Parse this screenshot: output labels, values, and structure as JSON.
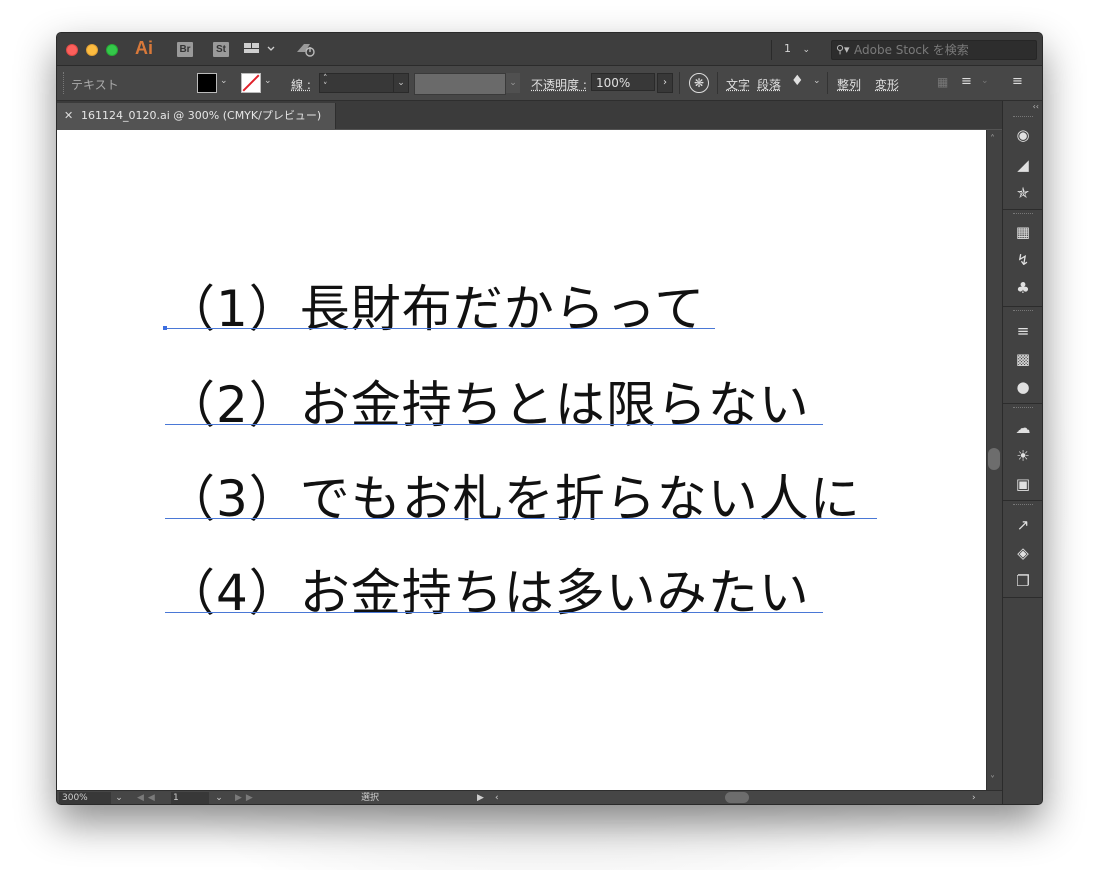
{
  "titlebar": {
    "app_logo": "Ai",
    "bridge_label": "Br",
    "stock_label": "St",
    "workspace_icon": "workspace-grid-icon",
    "sync_icon": "gpu-sync-icon",
    "page_number": "1",
    "search_placeholder": "Adobe Stock を検索"
  },
  "controlbar": {
    "selection_label": "テキスト",
    "fill_color": "#000000",
    "stroke_color": "none",
    "stroke_label": "線",
    "opacity_label": "不透明度",
    "opacity_value": "100%",
    "character_label": "文字",
    "paragraph_label": "段落",
    "align_label": "整列",
    "transform_label": "変形"
  },
  "document_tab": {
    "title": "161124_0120.ai @ 300% (CMYK/プレビュー)"
  },
  "canvas": {
    "lines": [
      "（1）長財布だからって",
      "（2）お金持ちとは限らない",
      "（3）でもお札を折らない人に",
      "（4）お金持ちは多いみたい"
    ]
  },
  "statusbar": {
    "zoom": "300%",
    "artboard": "1",
    "status_text": "選択"
  },
  "colors": {
    "accent_orange": "#d9793a",
    "baseline_blue": "#4a78d6",
    "stroke_none_red": "#e0202a"
  }
}
